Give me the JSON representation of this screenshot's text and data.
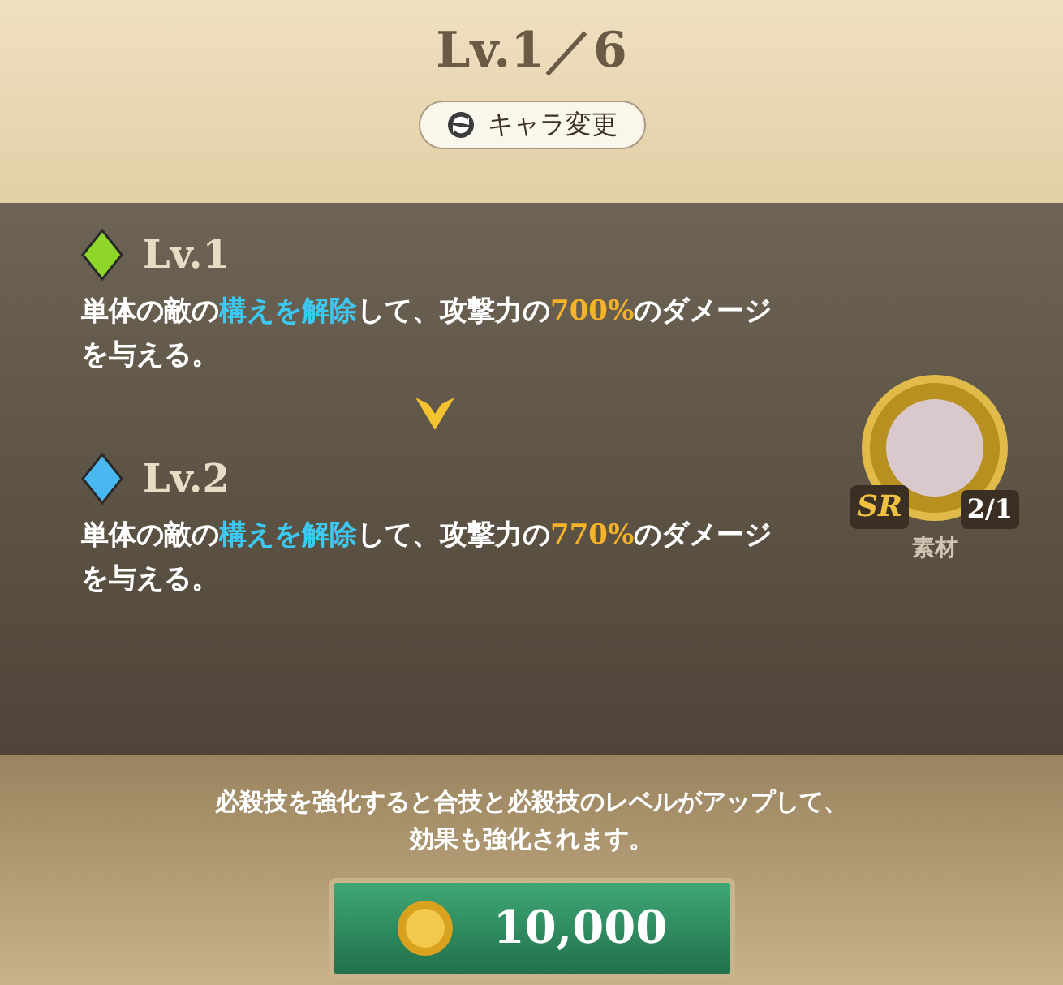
{
  "header": {
    "level_text": "Lv.1／6",
    "change_button": "キャラ変更"
  },
  "levels": [
    {
      "label": "Lv.1",
      "color": "#8fd62a",
      "description": [
        {
          "kind": "plain",
          "text": "単体の敵の"
        },
        {
          "kind": "keyword",
          "text": "構えを解除"
        },
        {
          "kind": "plain",
          "text": "して、攻撃力の"
        },
        {
          "kind": "value",
          "text": "700%"
        },
        {
          "kind": "plain",
          "text": "のダメージを与える。"
        }
      ]
    },
    {
      "label": "Lv.2",
      "color": "#4ab8f0",
      "description": [
        {
          "kind": "plain",
          "text": "単体の敵の"
        },
        {
          "kind": "keyword",
          "text": "構えを解除"
        },
        {
          "kind": "plain",
          "text": "して、攻撃力の"
        },
        {
          "kind": "value",
          "text": "770%"
        },
        {
          "kind": "plain",
          "text": "のダメージを与える。"
        }
      ]
    }
  ],
  "material": {
    "rarity": "SR",
    "count": "2/1",
    "label": "素材"
  },
  "footer": {
    "notice_lines": [
      "必殺技を強化すると合技と必殺技のレベルがアップして、",
      "効果も強化されます。"
    ],
    "cost_button": "10,000"
  }
}
